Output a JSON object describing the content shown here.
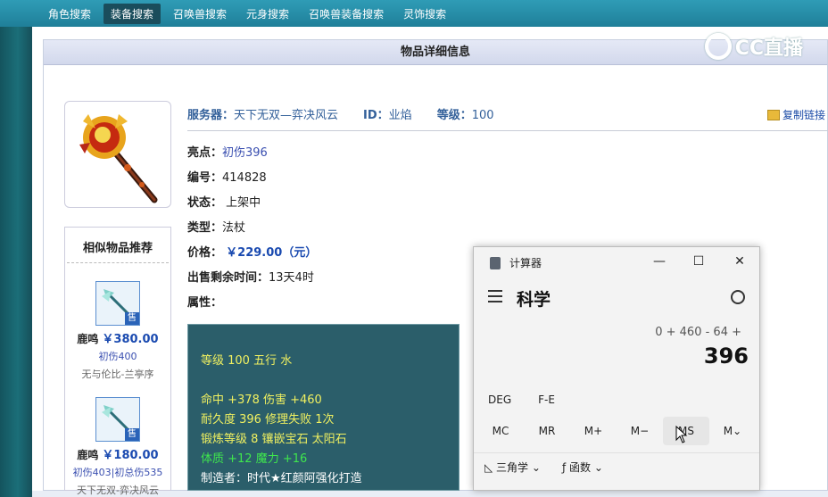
{
  "nav": {
    "items": [
      "角色搜索",
      "装备搜索",
      "召唤兽搜索",
      "元身搜索",
      "召唤兽装备搜索",
      "灵饰搜索"
    ],
    "active_index": 1
  },
  "panel": {
    "title": "物品详细信息"
  },
  "logo": {
    "text": "CC直播"
  },
  "info": {
    "server_label": "服务器：",
    "server_value": "天下无双—弈决风云",
    "id_label": "ID：",
    "id_value": "业焰",
    "level_label": "等级：",
    "level_value": "100",
    "copy_link": "复制链接"
  },
  "details": {
    "highlight_label": "亮点：",
    "highlight_value": "初伤396",
    "number_label": "编号：",
    "number_value": "414828",
    "status_label": "状态：",
    "status_value": "上架中",
    "type_label": "类型：",
    "type_value": "法杖",
    "price_label": "价格：",
    "price_value": "￥229.00（元）",
    "remain_label": "出售剩余时间：",
    "remain_value": "13天4时",
    "attr_label": "属性："
  },
  "attributes": {
    "line1": "等级 100 五行 水",
    "line2": "命中 +378 伤害 +460",
    "line3": "耐久度 396 修理失败 1次",
    "line4": "锻炼等级 8 镶嵌宝石 太阳石",
    "line5": "体质 +12 魔力 +16",
    "line6": "制造者：时代★红颜阿强化打造"
  },
  "similar": {
    "title": "相似物品推荐",
    "items": [
      {
        "name": "鹿鸣",
        "price": "￥380.00",
        "sub": "初伤400",
        "server": "无与伦比-兰亭序",
        "tag": "售"
      },
      {
        "name": "鹿鸣",
        "price": "￥180.00",
        "sub": "初伤403|初总伤535",
        "server": "天下无双-弈决风云",
        "tag": "售"
      }
    ]
  },
  "calculator": {
    "window_title": "计算器",
    "mode": "科学",
    "expression": "0 + 460 - 64 +",
    "result": "396",
    "deg": "DEG",
    "fe": "F-E",
    "memory": [
      "MC",
      "MR",
      "M+",
      "M−",
      "MS",
      "M⌄"
    ],
    "trig": "三角学",
    "func": "函数"
  }
}
